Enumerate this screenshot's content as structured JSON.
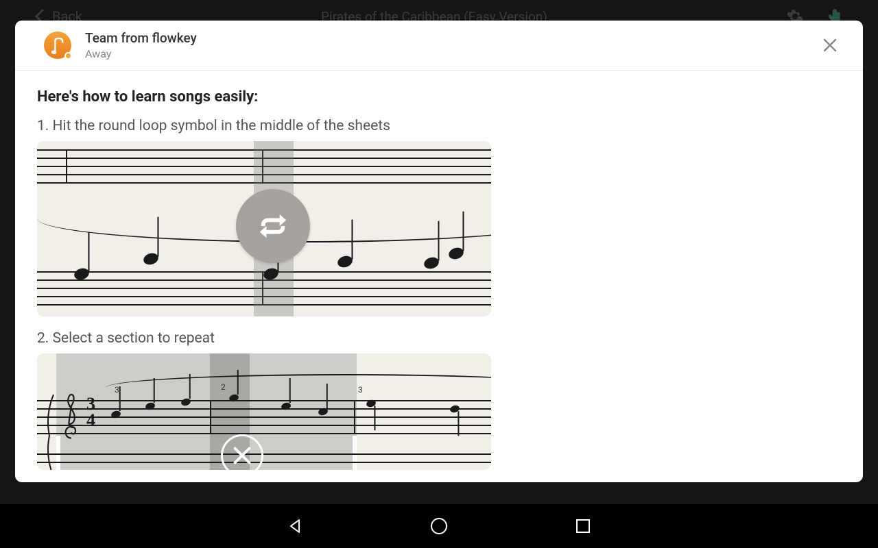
{
  "background": {
    "back_label": "Back",
    "title": "Pirates of the Caribbean (Easy Version)"
  },
  "modal": {
    "sender_name": "Team from flowkey",
    "sender_status": "Away",
    "heading": "Here's how to learn songs easily:",
    "step1": "1. Hit the round loop symbol in the middle of the sheets",
    "step2": "2. Select a section to repeat"
  }
}
